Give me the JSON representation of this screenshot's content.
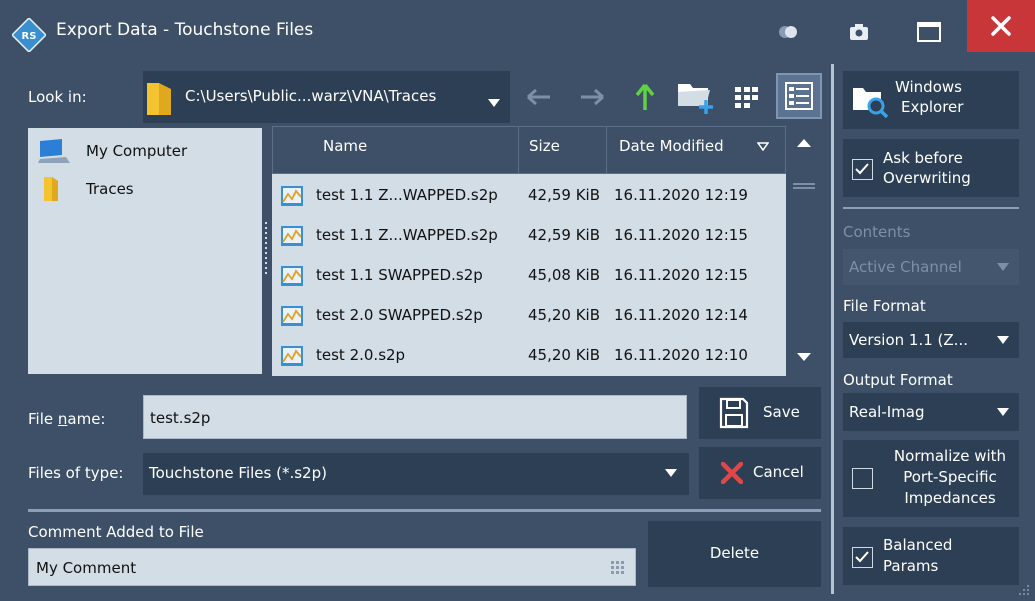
{
  "window": {
    "title": "Export Data - Touchstone Files",
    "logo_icon": "rs-logo-icon",
    "close_color": "#c8363a"
  },
  "nav": {
    "look_in_label": "Look in:",
    "look_in_path": "C:\\Users\\Public...warz\\VNA\\Traces",
    "accent": "#5fd142"
  },
  "places": [
    {
      "label": "My Computer",
      "icon": "computer-icon"
    },
    {
      "label": "Traces",
      "icon": "folder-icon"
    }
  ],
  "file_list": {
    "columns": [
      "Name",
      "Size",
      "Date Modified"
    ],
    "rows": [
      {
        "name": "test 1.1 Z...WAPPED.s2p",
        "size": "42,59 KiB",
        "date": "16.11.2020 12:19"
      },
      {
        "name": "test 1.1 Z...WAPPED.s2p",
        "size": "42,59 KiB",
        "date": "16.11.2020 12:15"
      },
      {
        "name": "test 1.1 SWAPPED.s2p",
        "size": "45,08 KiB",
        "date": "16.11.2020 12:15"
      },
      {
        "name": "test 2.0 SWAPPED.s2p",
        "size": "45,20 KiB",
        "date": "16.11.2020 12:14"
      },
      {
        "name": "test 2.0.s2p",
        "size": "45,20 KiB",
        "date": "16.11.2020 12:10"
      }
    ]
  },
  "filename": {
    "label_pre": "File ",
    "label_u": "n",
    "label_post": "ame:",
    "value": "test.s2p"
  },
  "filetype": {
    "label": "Files of type:",
    "value": "Touchstone Files (*.s2p)"
  },
  "buttons": {
    "save": "Save",
    "cancel": "Cancel",
    "delete": "Delete"
  },
  "comment": {
    "label": "Comment Added to File",
    "value": "My Comment"
  },
  "right_panel": {
    "windows_explorer_line1": "Windows",
    "windows_explorer_line2": "Explorer",
    "ask_line1": "Ask before",
    "ask_line2": "Overwriting",
    "ask_checked": true,
    "contents_label": "Contents",
    "contents_value": "Active Channel",
    "file_format_label": "File Format",
    "file_format_value": "Version 1.1 (Z...",
    "output_format_label": "Output Format",
    "output_format_value": "Real-Imag",
    "normalize_line1": "Normalize with",
    "normalize_line2": "Port-Specific",
    "normalize_line3": "Impedances",
    "normalize_checked": false,
    "balanced_line1": "Balanced",
    "balanced_line2": "Params",
    "balanced_checked": true
  }
}
